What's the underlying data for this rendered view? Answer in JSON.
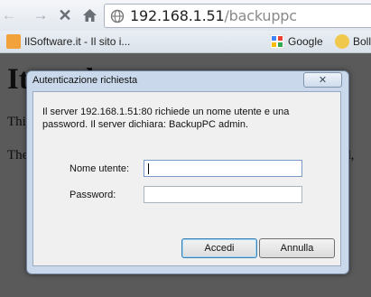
{
  "browser": {
    "url_host": "192.168.1.51",
    "url_path": "/backuppc",
    "bookmarks": [
      {
        "label": "IlSoftware.it - Il sito i..."
      },
      {
        "label": "Google"
      },
      {
        "label": "Boll"
      }
    ]
  },
  "page": {
    "heading": "It work",
    "line1": "Thi",
    "line2": "The",
    "line2_end": "ded,"
  },
  "dialog": {
    "title": "Autenticazione richiesta",
    "message": "Il server 192.168.1.51:80 richiede un nome utente e una password. Il server dichiara: BackupPC admin.",
    "username_label": "Nome utente:",
    "password_label": "Password:",
    "username_value": "",
    "password_value": "",
    "ok_label": "Accedi",
    "cancel_label": "Annulla"
  },
  "icons": {
    "back": "arrow-left",
    "forward": "arrow-right",
    "stop": "close-x",
    "home": "house",
    "security": "globe",
    "close": "x"
  }
}
